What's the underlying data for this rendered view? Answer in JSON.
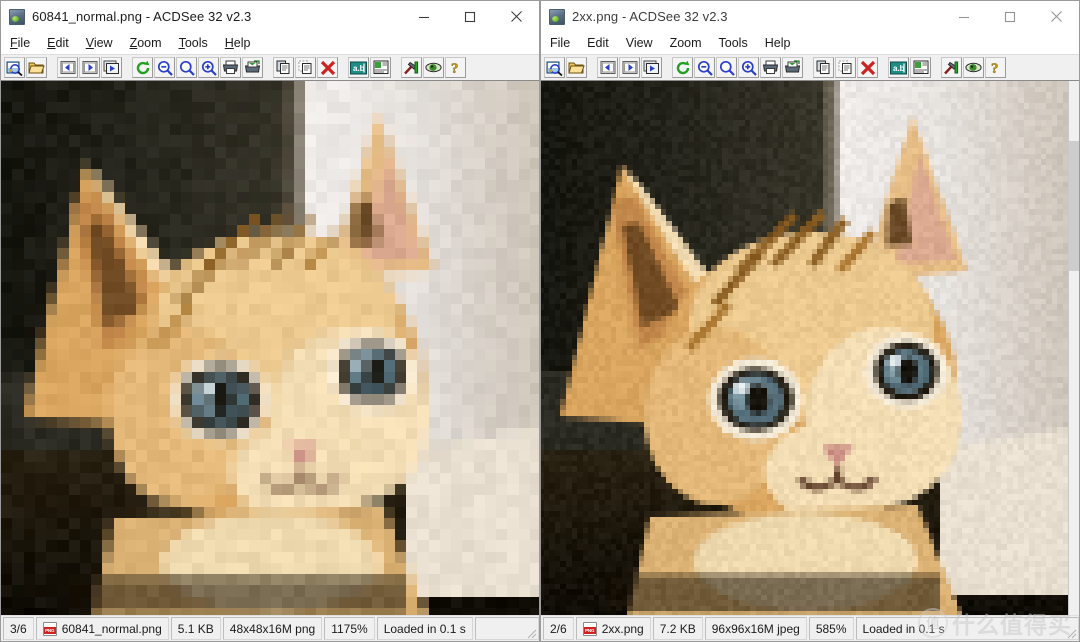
{
  "app": {
    "name": "ACDSee 32 v2.3"
  },
  "windows": [
    {
      "id": "left",
      "title": "60841_normal.png - ACDSee 32 v2.3",
      "title_icon": "image-file-icon",
      "menus": [
        {
          "label": "File",
          "mnemonic": "F"
        },
        {
          "label": "Edit",
          "mnemonic": "E"
        },
        {
          "label": "View",
          "mnemonic": "V"
        },
        {
          "label": "Zoom",
          "mnemonic": "Z"
        },
        {
          "label": "Tools",
          "mnemonic": "T"
        },
        {
          "label": "Help",
          "mnemonic": "H"
        }
      ],
      "toolbar": [
        {
          "name": "browse-icon",
          "title": "Browse"
        },
        {
          "name": "open-folder-icon",
          "title": "Open"
        },
        {
          "gap": true
        },
        {
          "name": "previous-image-icon",
          "title": "Previous"
        },
        {
          "name": "next-image-icon",
          "title": "Next"
        },
        {
          "name": "slideshow-icon",
          "title": "Slide Show"
        },
        {
          "gap": true
        },
        {
          "name": "rotate-icon",
          "title": "Rotate"
        },
        {
          "name": "zoom-out-icon",
          "title": "Zoom Out"
        },
        {
          "name": "zoom-normal-icon",
          "title": "Zoom 1:1"
        },
        {
          "name": "zoom-in-icon",
          "title": "Zoom In"
        },
        {
          "name": "print-icon",
          "title": "Print"
        },
        {
          "name": "send-icon",
          "title": "Send"
        },
        {
          "gap": true
        },
        {
          "name": "copy-icon",
          "title": "Copy"
        },
        {
          "name": "paste-icon",
          "title": "Paste"
        },
        {
          "name": "delete-icon",
          "title": "Delete"
        },
        {
          "gap": true
        },
        {
          "name": "rename-icon",
          "title": "Rename"
        },
        {
          "name": "properties-icon",
          "title": "Properties"
        },
        {
          "gap": true
        },
        {
          "name": "tools-icon",
          "title": "Tools"
        },
        {
          "name": "preview-icon",
          "title": "Preview"
        },
        {
          "name": "help-icon",
          "title": "Help"
        }
      ],
      "window_buttons": [
        {
          "name": "minimize-button",
          "glyph": "minimize"
        },
        {
          "name": "maximize-button",
          "glyph": "maximize"
        },
        {
          "name": "close-button",
          "glyph": "close"
        }
      ],
      "status": {
        "index": "3/6",
        "filename": "60841_normal.png",
        "filesize": "5.1 KB",
        "dimensions": "48x48x16M png",
        "zoom": "1175%",
        "loaded": "Loaded in 0.1 s",
        "extra": ""
      },
      "image": {
        "kind": "cat-photo-pixelated",
        "source_width": 48,
        "source_height": 48,
        "zoom_percent": 1175,
        "scrollbar": false
      }
    },
    {
      "id": "right",
      "title": "2xx.png - ACDSee 32 v2.3",
      "title_icon": "image-file-icon",
      "menus": [
        {
          "label": "File",
          "mnemonic": ""
        },
        {
          "label": "Edit",
          "mnemonic": ""
        },
        {
          "label": "View",
          "mnemonic": ""
        },
        {
          "label": "Zoom",
          "mnemonic": ""
        },
        {
          "label": "Tools",
          "mnemonic": ""
        },
        {
          "label": "Help",
          "mnemonic": ""
        }
      ],
      "toolbar": [
        {
          "name": "browse-icon",
          "title": "Browse"
        },
        {
          "name": "open-folder-icon",
          "title": "Open"
        },
        {
          "gap": true
        },
        {
          "name": "previous-image-icon",
          "title": "Previous"
        },
        {
          "name": "next-image-icon",
          "title": "Next"
        },
        {
          "name": "slideshow-icon",
          "title": "Slide Show"
        },
        {
          "gap": true
        },
        {
          "name": "rotate-icon",
          "title": "Rotate"
        },
        {
          "name": "zoom-out-icon",
          "title": "Zoom Out"
        },
        {
          "name": "zoom-normal-icon",
          "title": "Zoom 1:1"
        },
        {
          "name": "zoom-in-icon",
          "title": "Zoom In"
        },
        {
          "name": "print-icon",
          "title": "Print"
        },
        {
          "name": "send-icon",
          "title": "Send"
        },
        {
          "gap": true
        },
        {
          "name": "copy-icon",
          "title": "Copy"
        },
        {
          "name": "paste-icon",
          "title": "Paste"
        },
        {
          "name": "delete-icon",
          "title": "Delete"
        },
        {
          "gap": true
        },
        {
          "name": "rename-icon",
          "title": "Rename"
        },
        {
          "name": "properties-icon",
          "title": "Properties"
        },
        {
          "gap": true
        },
        {
          "name": "tools-icon",
          "title": "Tools"
        },
        {
          "name": "preview-icon",
          "title": "Preview"
        },
        {
          "name": "help-icon",
          "title": "Help"
        }
      ],
      "window_buttons": [
        {
          "name": "minimize-button",
          "glyph": "minimize"
        },
        {
          "name": "maximize-button",
          "glyph": "maximize"
        },
        {
          "name": "close-button",
          "glyph": "close"
        }
      ],
      "status": {
        "index": "2/6",
        "filename": "2xx.png",
        "filesize": "7.2 KB",
        "dimensions": "96x96x16M jpeg",
        "zoom": "585%",
        "loaded": "Loaded in 0.1 s",
        "extra": ""
      },
      "image": {
        "kind": "cat-photo-smooth",
        "source_width": 96,
        "source_height": 96,
        "zoom_percent": 585,
        "scrollbar": true
      }
    }
  ],
  "watermark": {
    "logo_glyph": "值",
    "text": "什么值得买"
  },
  "colors": {
    "titlebar_bg": "#ffffff",
    "toolbar_bg": "#f0f0f0",
    "statusbar_bg": "#f0f0f0",
    "window_border": "#9b9b9b",
    "text": "#1b1b1b",
    "delete_red": "#cc2222",
    "rotate_green": "#21a021",
    "zoom_blue": "#2a3fc8",
    "png_red": "#cf2222"
  }
}
